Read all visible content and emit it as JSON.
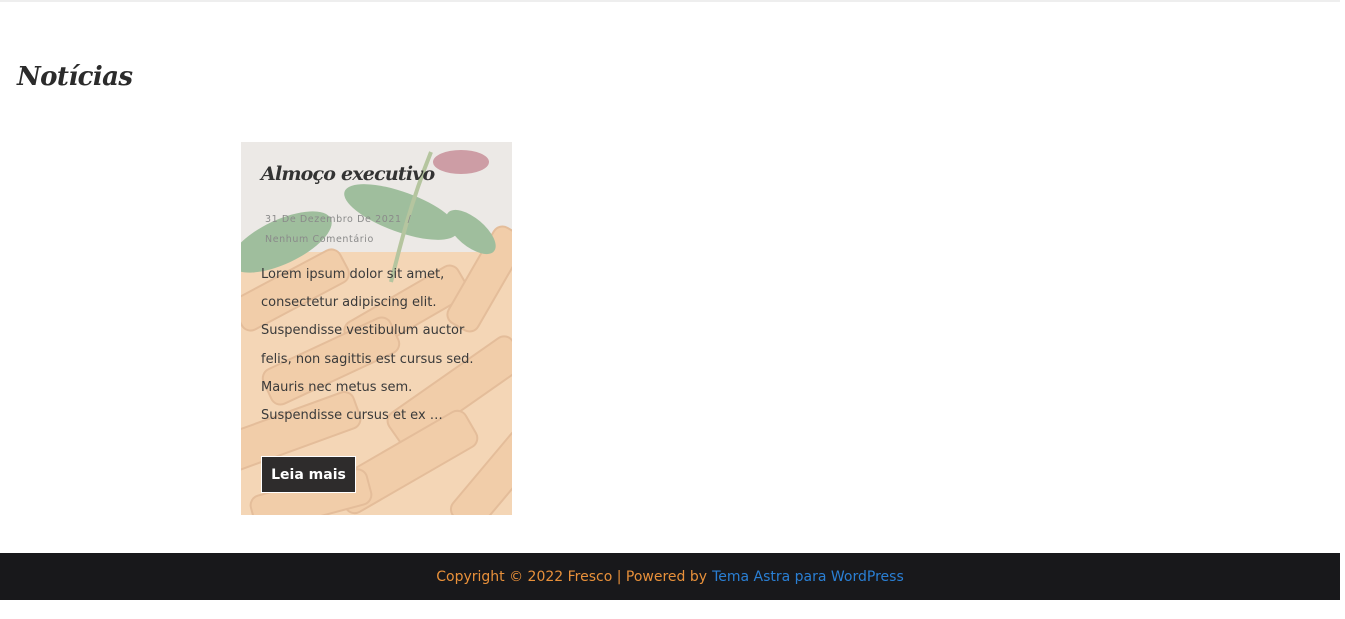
{
  "page": {
    "heading": "Notícias"
  },
  "post": {
    "title": "Almoço executivo",
    "date": "31 De Dezembro De 2021",
    "separator": "/",
    "comments": "Nenhum Comentário",
    "excerpt": "Lorem ipsum dolor sit amet, consectetur adipiscing elit. Suspendisse vestibulum auctor felis, non sagittis est cursus sed. Mauris nec metus sem. Suspendisse cursus et ex …",
    "read_more_label": "Leia mais",
    "background_image": "pasta-penne-image"
  },
  "footer": {
    "copyright": "Copyright © 2022 Fresco | Powered by",
    "theme_link": "Tema Astra para WordPress"
  },
  "colors": {
    "footer_background": "#18181b",
    "footer_text": "#e8903a",
    "footer_link": "#2a7fd4",
    "button_background": "#2e2c2c"
  }
}
